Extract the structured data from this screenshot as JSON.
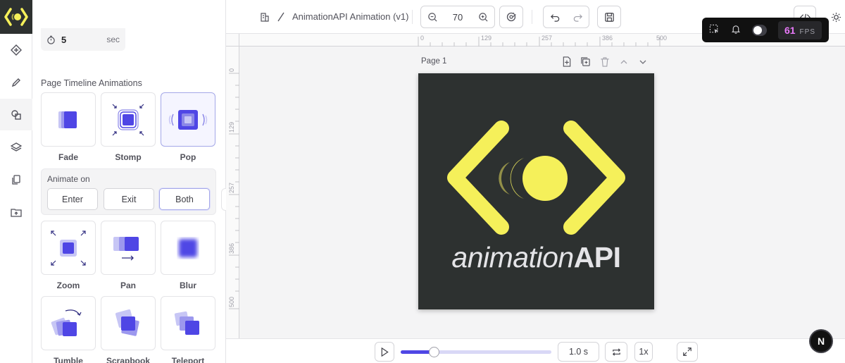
{
  "duration": {
    "value": "5",
    "unit": "sec"
  },
  "panel": {
    "section_title": "Page Timeline Animations",
    "presets_top": [
      {
        "label": "Fade",
        "icon": "fade-icon"
      },
      {
        "label": "Stomp",
        "icon": "stomp-icon"
      },
      {
        "label": "Pop",
        "icon": "pop-icon",
        "selected": true
      }
    ],
    "animate_on": {
      "label": "Animate on",
      "options": [
        "Enter",
        "Exit",
        "Both"
      ],
      "selected": "Both"
    },
    "presets_bottom": [
      {
        "label": "Zoom",
        "icon": "zoom-icon"
      },
      {
        "label": "Pan",
        "icon": "pan-icon"
      },
      {
        "label": "Blur",
        "icon": "blur-icon"
      },
      {
        "label": "Tumble",
        "icon": "tumble-icon"
      },
      {
        "label": "Scrapbook",
        "icon": "scrapbook-icon"
      },
      {
        "label": "Teleport",
        "icon": "teleport-icon"
      }
    ]
  },
  "topbar": {
    "title": "AnimationAPI Animation (v1)",
    "zoom": "70"
  },
  "fps": {
    "value": "61",
    "label": "FPS"
  },
  "rulers": {
    "top": [
      "0",
      "129",
      "257",
      "386",
      "500"
    ],
    "left": [
      "0",
      "129",
      "257",
      "386",
      "500"
    ]
  },
  "page": {
    "label": "Page 1"
  },
  "artboard": {
    "word_light": "animation",
    "word_bold": "API",
    "background": "#2d3130",
    "accent": "#f5f05a"
  },
  "playback": {
    "time": "1.0 s",
    "speed": "1x",
    "progress": 0.22
  },
  "colors": {
    "accent": "#4f46e5",
    "brand_yellow": "#f5f05a"
  },
  "badge": "N"
}
